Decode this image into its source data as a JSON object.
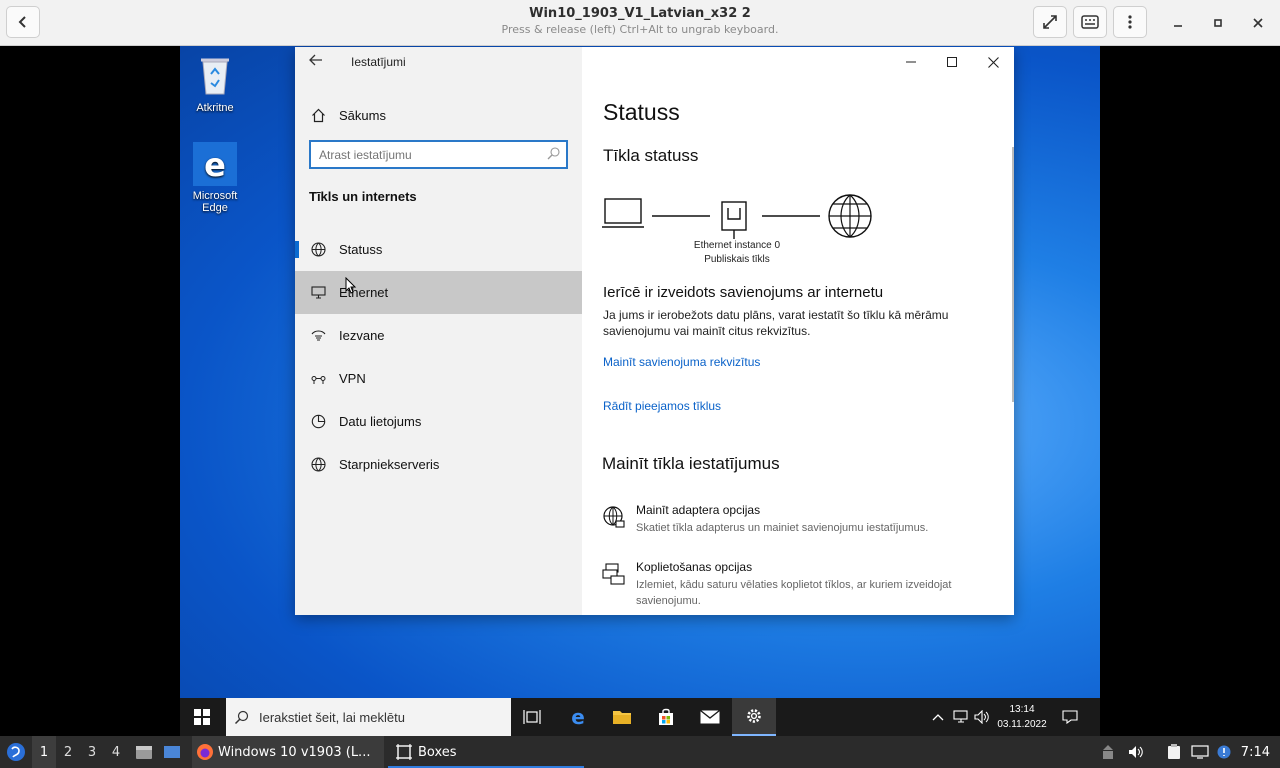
{
  "boxes": {
    "title": "Win10_1903_V1_Latvian_x32 2",
    "subtitle": "Press & release (left) Ctrl+Alt to ungrab keyboard."
  },
  "desktop": {
    "icons": [
      {
        "label": "Atkritne",
        "icon": "recycle-bin-icon"
      },
      {
        "label": "Microsoft Edge",
        "icon": "edge-icon"
      }
    ]
  },
  "settings": {
    "window_title": "Iestatījumi",
    "home_label": "Sākums",
    "search_placeholder": "Atrast iestatījumu",
    "section_title": "Tīkls un internets",
    "nav": [
      {
        "label": "Statuss",
        "icon": "status-globe-icon",
        "selected": true
      },
      {
        "label": "Ethernet",
        "icon": "ethernet-icon",
        "hovered": true
      },
      {
        "label": "Iezvane",
        "icon": "dialup-icon"
      },
      {
        "label": "VPN",
        "icon": "vpn-icon"
      },
      {
        "label": "Datu lietojums",
        "icon": "data-usage-icon"
      },
      {
        "label": "Starpniekserveris",
        "icon": "proxy-globe-icon"
      }
    ],
    "main": {
      "title": "Statuss",
      "network_status_heading": "Tīkla statuss",
      "adapter_name": "Ethernet instance 0",
      "network_type": "Publiskais tīkls",
      "connected_heading": "Ierīcē ir izveidots savienojums ar internetu",
      "info_text": "Ja jums ir ierobežots datu plāns, varat iestatīt šo tīklu kā mērāmu savienojumu vai mainīt citus rekvizītus.",
      "link_change_props": "Mainīt savienojuma rekvizītus",
      "link_show_networks": "Rādīt pieejamos tīklus",
      "change_settings_heading": "Mainīt tīkla iestatījumus",
      "options": [
        {
          "title": "Mainīt adaptera opcijas",
          "desc": "Skatiet tīkla adapterus un mainiet savienojumu iestatījumus.",
          "icon": "adapter-globe-icon"
        },
        {
          "title": "Koplietošanas opcijas",
          "desc": "Izlemiet, kādu saturu vēlaties koplietot tīklos, ar kuriem izveidojat savienojumu.",
          "icon": "sharing-icon"
        }
      ]
    }
  },
  "win_taskbar": {
    "search_placeholder": "Ierakstiet šeit, lai meklētu",
    "time": "13:14",
    "date": "03.11.2022"
  },
  "host_panel": {
    "workspaces": [
      "1",
      "2",
      "3",
      "4"
    ],
    "tasks": [
      {
        "label": "Windows 10 v1903 (L...",
        "icon": "firefox-icon"
      },
      {
        "label": "Boxes",
        "icon": "boxes-icon"
      }
    ],
    "clock": "7:14"
  }
}
